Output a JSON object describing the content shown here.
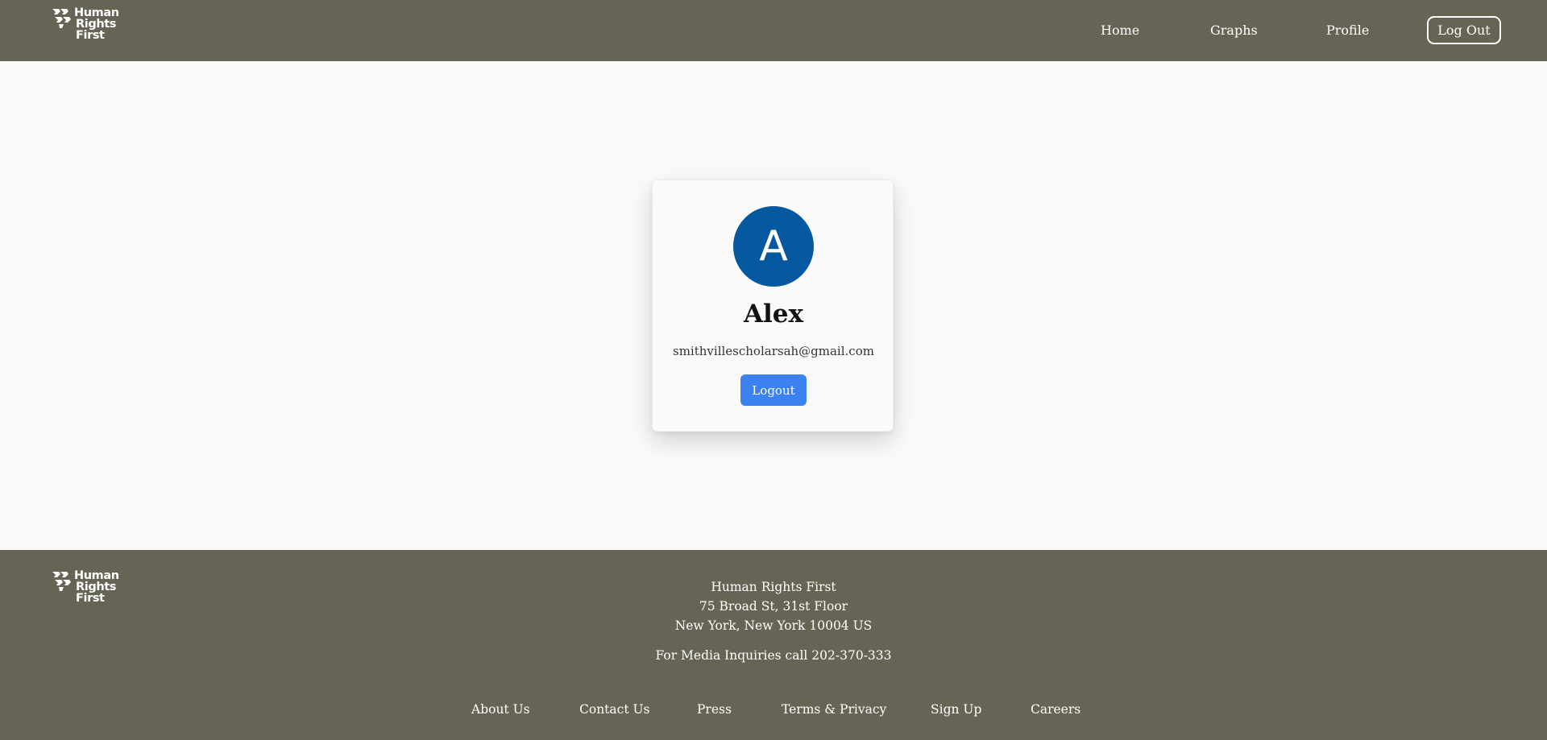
{
  "brand": {
    "logo_lines": [
      "Human",
      "Rights",
      "First"
    ],
    "logo_icon": "hrf-flags-icon",
    "header_bg": "#666555",
    "accent": "#3b82f0",
    "avatar_bg": "#0358a0"
  },
  "nav": {
    "home": "Home",
    "graphs": "Graphs",
    "profile": "Profile",
    "logout": "Log Out"
  },
  "profile": {
    "avatar_initial": "A",
    "name": "Alex",
    "email": "smithvillescholarsah@gmail.com",
    "logout": "Logout"
  },
  "footer": {
    "org": "Human Rights First",
    "address1": "75 Broad St, 31st Floor",
    "address2": "New York, New York 10004 US",
    "media": "For Media Inquiries call 202-370-333",
    "links": {
      "about": "About Us",
      "contact": "Contact Us",
      "press": "Press",
      "terms": "Terms & Privacy",
      "signup": "Sign Up",
      "careers": "Careers"
    }
  }
}
